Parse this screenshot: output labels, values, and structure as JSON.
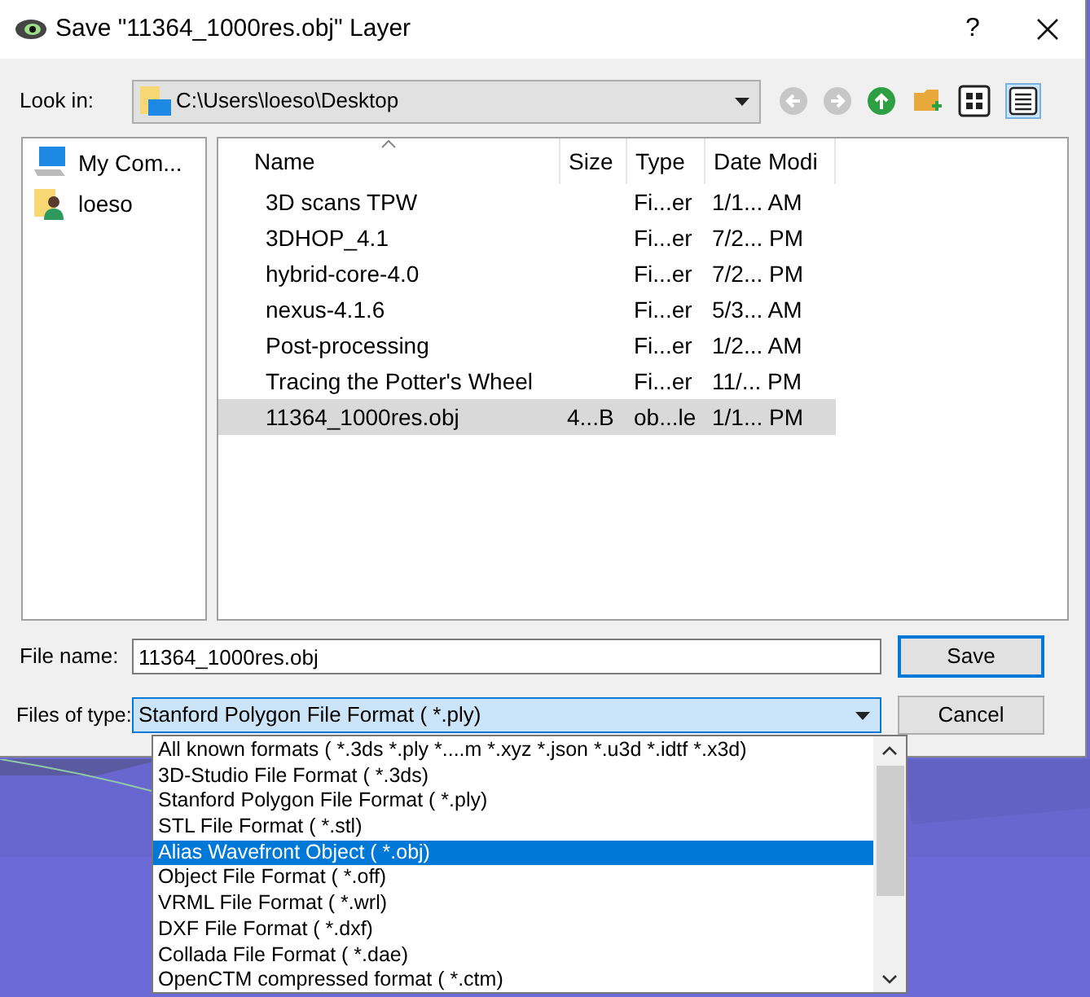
{
  "window": {
    "title": "Save \"11364_1000res.obj\" Layer",
    "help": "?"
  },
  "look_in": {
    "label": "Look in:",
    "path": "C:\\Users\\loeso\\Desktop"
  },
  "sidebar": {
    "items": [
      {
        "label": "My Com...",
        "kind": "computer"
      },
      {
        "label": "loeso",
        "kind": "user"
      }
    ]
  },
  "table": {
    "columns": [
      {
        "label": "Name",
        "sorted": true
      },
      {
        "label": "Size",
        "sorted": false
      },
      {
        "label": "Type",
        "sorted": false
      },
      {
        "label": "Date Modi",
        "sorted": false
      }
    ],
    "rows": [
      {
        "name": "3D scans TPW",
        "size": "",
        "type": "Fi...er",
        "date": "1/1... AM",
        "selected": false
      },
      {
        "name": "3DHOP_4.1",
        "size": "",
        "type": "Fi...er",
        "date": "7/2... PM",
        "selected": false
      },
      {
        "name": "hybrid-core-4.0",
        "size": "",
        "type": "Fi...er",
        "date": "7/2... PM",
        "selected": false
      },
      {
        "name": "nexus-4.1.6",
        "size": "",
        "type": "Fi...er",
        "date": "5/3... AM",
        "selected": false
      },
      {
        "name": "Post-processing",
        "size": "",
        "type": "Fi...er",
        "date": "1/2... AM",
        "selected": false
      },
      {
        "name": "Tracing the Potter's Wheel",
        "size": "",
        "type": "Fi...er",
        "date": "11/... PM",
        "selected": false
      },
      {
        "name": "11364_1000res.obj",
        "size": "4...B",
        "type": "ob...le",
        "date": "1/1... PM",
        "selected": true
      }
    ]
  },
  "file_name": {
    "label": "File name:",
    "value": "11364_1000res.obj"
  },
  "file_type": {
    "label": "Files of type:",
    "value": "Stanford Polygon File Format ( *.ply)",
    "expanded": true
  },
  "buttons": [
    {
      "label": "Save",
      "default": true
    },
    {
      "label": "Cancel",
      "default": false
    }
  ],
  "dropdown": {
    "options": [
      {
        "label": "All known formats ( *.3ds *.ply *....m *.xyz *.json *.u3d *.idtf *.x3d)",
        "selected": false
      },
      {
        "label": "3D-Studio File Format ( *.3ds)",
        "selected": false
      },
      {
        "label": "Stanford Polygon File Format ( *.ply)",
        "selected": false
      },
      {
        "label": "STL File Format ( *.stl)",
        "selected": false
      },
      {
        "label": "Alias Wavefront Object ( *.obj)",
        "selected": true
      },
      {
        "label": "Object File Format ( *.off)",
        "selected": false
      },
      {
        "label": "VRML File Format ( *.wrl)",
        "selected": false
      },
      {
        "label": "DXF File Format ( *.dxf)",
        "selected": false
      },
      {
        "label": "Collada File Format ( *.dae)",
        "selected": false
      },
      {
        "label": "OpenCTM compressed format ( *.ctm)",
        "selected": false
      }
    ]
  }
}
